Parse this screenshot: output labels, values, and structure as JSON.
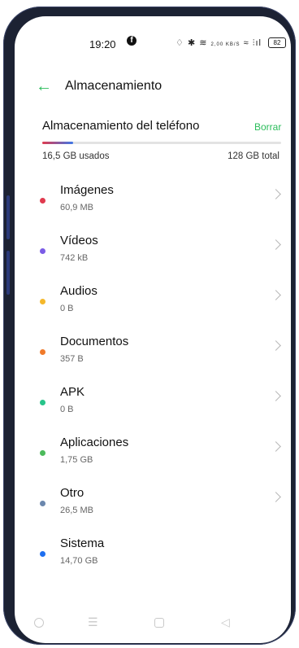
{
  "status_bar": {
    "time": "19:20",
    "net_speed": "2,00 KB/S",
    "battery": "82"
  },
  "header": {
    "back_icon": "arrow-left-icon",
    "title": "Almacenamiento"
  },
  "storage": {
    "title": "Almacenamiento del teléfono",
    "clear_label": "Borrar",
    "used_label": "16,5 GB usados",
    "total_label": "128 GB total",
    "used_fraction": 0.13
  },
  "categories": [
    {
      "name": "Imágenes",
      "size": "60,9 MB",
      "color": "#e03a4e",
      "has_chevron": true
    },
    {
      "name": "Vídeos",
      "size": "742 kB",
      "color": "#7b5ce6",
      "has_chevron": true
    },
    {
      "name": "Audios",
      "size": "0 B",
      "color": "#f5b82b",
      "has_chevron": true
    },
    {
      "name": "Documentos",
      "size": "357 B",
      "color": "#f07a2a",
      "has_chevron": true
    },
    {
      "name": "APK",
      "size": "0 B",
      "color": "#27c48a",
      "has_chevron": true
    },
    {
      "name": "Aplicaciones",
      "size": "1,75 GB",
      "color": "#4cba5b",
      "has_chevron": true
    },
    {
      "name": "Otro",
      "size": "26,5 MB",
      "color": "#6b87ad",
      "has_chevron": true
    },
    {
      "name": "Sistema",
      "size": "14,70 GB",
      "color": "#1e6ff0",
      "has_chevron": false
    }
  ],
  "accent_color": "#2bbd5b"
}
